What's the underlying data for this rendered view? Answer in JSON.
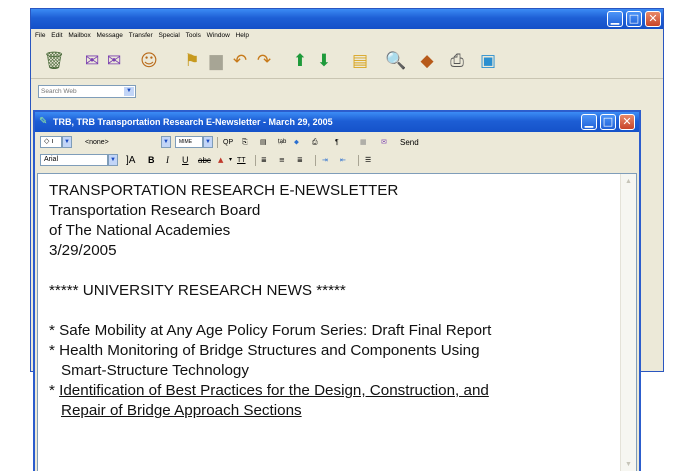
{
  "colors": {
    "titlebar_blue": "#1d5fd5",
    "chrome": "#ece9d8",
    "close_red": "#c8452a"
  },
  "outer_window": {
    "menu": [
      "File",
      "Edit",
      "Mailbox",
      "Message",
      "Transfer",
      "Special",
      "Tools",
      "Window",
      "Help"
    ],
    "toolbar_icons": [
      "trash-icon",
      "get-mail-icon",
      "send-queued-icon",
      "address-book-icon",
      "filter-icon",
      "printer-gray-icon",
      "reply-icon",
      "reply-all-icon",
      "forward-arrow-up-icon",
      "redirect-arrow-down-icon",
      "new-message-icon",
      "find-icon",
      "stationery-icon",
      "print-icon",
      "options-icon"
    ],
    "search": {
      "placeholder": "Search Web"
    }
  },
  "message_window": {
    "title": "TRB, TRB Transportation Research E-Newsletter - March 29, 2005",
    "format_row1": {
      "priority": "◇ ı",
      "signature": "<none>",
      "encoding": "MIME",
      "send_label": "Send"
    },
    "format_row2": {
      "font": "Arial"
    },
    "body": {
      "heading": "TRANSPORTATION RESEARCH E-NEWSLETTER",
      "org_line1": "Transportation Research Board",
      "org_line2": "of The National Academies",
      "date": "3/29/2005",
      "section": "***** UNIVERSITY RESEARCH NEWS *****",
      "items": [
        {
          "line1": "* Safe Mobility at Any Age Policy Forum Series: Draft Final Report"
        },
        {
          "line1": "* Health Monitoring of Bridge Structures and Components Using",
          "line2": "Smart-Structure Technology"
        },
        {
          "prefix": "* ",
          "line1": "Identification of Best Practices for the Design, Construction, and",
          "line2": "Repair of Bridge Approach Sections"
        }
      ]
    }
  }
}
